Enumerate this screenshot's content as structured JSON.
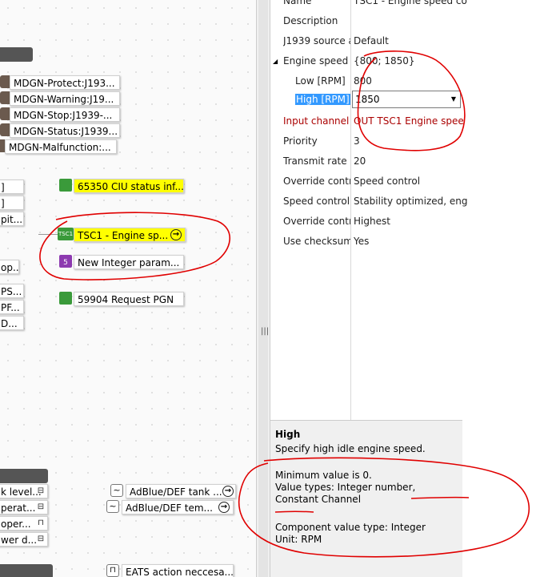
{
  "canvas": {
    "protect_nodes": [
      "MDGN-Protect:J193...",
      "MDGN-Warning:J19...",
      "MDGN-Stop:J1939-...",
      "MDGN-Status:J1939..."
    ],
    "malfunction_node": "MDGN-Malfunction:...",
    "left_fragments": [
      "]",
      "]",
      "pit...",
      "op...",
      "PS...",
      "PF...",
      "D..."
    ],
    "ciu_node": "65350 CIU status inf...",
    "tsc1_node": "TSC1 - Engine sp...",
    "integer_node": "New Integer param...",
    "request_node": "59904 Request PGN",
    "bottom_left_fragments": [
      "k level...",
      "perat...",
      "oper...",
      "wer d..."
    ],
    "adblue_tank": "AdBlue/DEF tank ...",
    "adblue_temp": "AdBlue/DEF tem...",
    "eats_node": "EATS action neccesa...",
    "icon_labels": {
      "tsc1": "TSC1",
      "integer": "5"
    }
  },
  "properties": {
    "rows": [
      {
        "key": "Name",
        "value": "TSC1 - Engine speed co"
      },
      {
        "key": "Description",
        "value": ""
      },
      {
        "key": "J1939 source a",
        "value": "Default"
      },
      {
        "key": "Engine speed",
        "value": "{800; 1850}"
      },
      {
        "key": "Low [RPM]",
        "value": "800"
      },
      {
        "key": "High [RPM]",
        "value": "1850"
      },
      {
        "key": "Input channel |",
        "value": "OUT TSC1 Engine spee"
      },
      {
        "key": "Priority",
        "value": "3"
      },
      {
        "key": "Transmit rate |",
        "value": "20"
      },
      {
        "key": "Override contr",
        "value": "Speed control"
      },
      {
        "key": "Speed control",
        "value": "Stability optimized, eng"
      },
      {
        "key": "Override contr",
        "value": "Highest"
      },
      {
        "key": "Use checksum",
        "value": "Yes"
      }
    ],
    "expander": "◢",
    "dropdown_arrow": "▼"
  },
  "help": {
    "title": "High",
    "description": "Specify high idle engine speed.",
    "minimum": "Minimum value is 0.",
    "value_types": "Value types: Integer number, Constant Channel",
    "component_type": "Component value type: Integer",
    "unit": "Unit: RPM"
  },
  "splitter_handle": "|||",
  "colors": {
    "highlight": "#ffff00",
    "selection": "#3399ff",
    "annotation": "#e00000",
    "error_text": "#aa0000"
  }
}
